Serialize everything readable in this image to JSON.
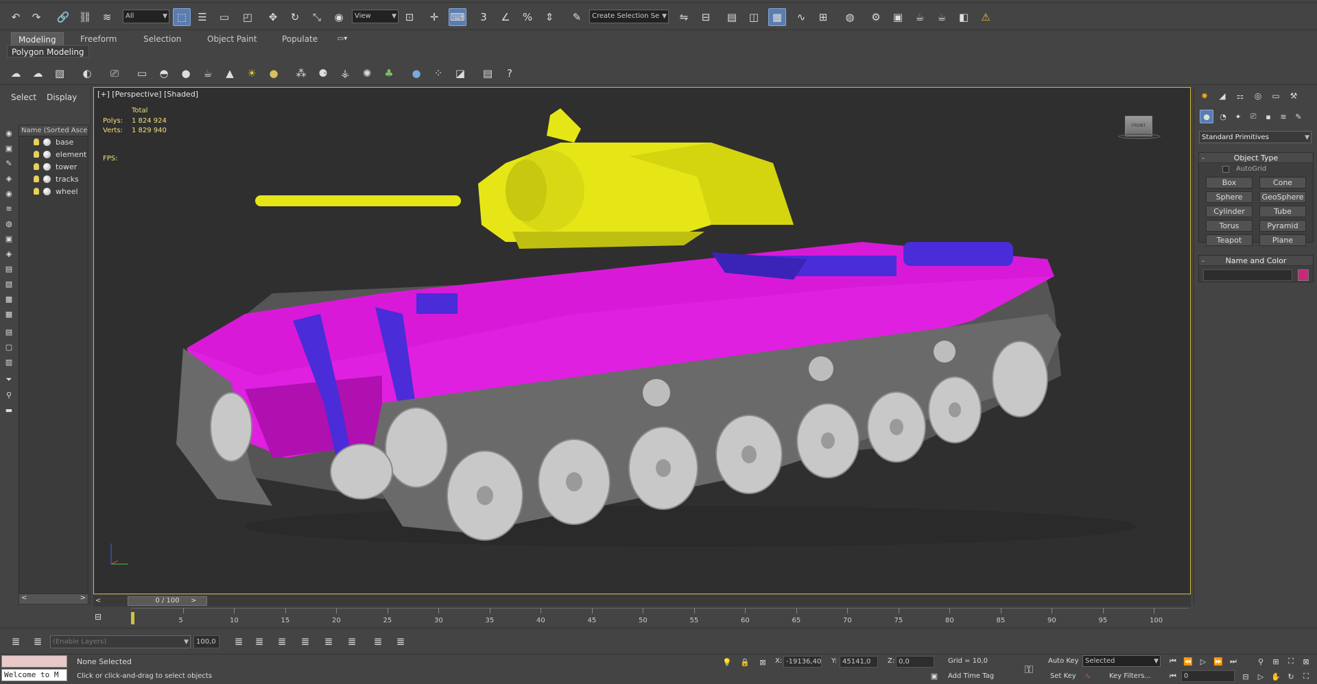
{
  "main_toolbar": {
    "selection_filter": "All",
    "reference_coord": "View",
    "named_selection_placeholder": "Create Selection Se",
    "snap_3d_label": "3",
    "percent_snap_label": "%"
  },
  "ribbon": {
    "tabs": [
      "Modeling",
      "Freeform",
      "Selection",
      "Object Paint",
      "Populate"
    ],
    "active_tab": "Modeling",
    "panel_label": "Polygon Modeling"
  },
  "explorer": {
    "tabs": [
      "Select",
      "Display"
    ],
    "column_header": "Name (Sorted Ascending)",
    "items": [
      "base",
      "element",
      "tower",
      "tracks",
      "wheel"
    ]
  },
  "viewport": {
    "label": "[+] [Perspective] [Shaded]",
    "stats": {
      "total_label": "Total",
      "polys_label": "Polys:",
      "polys_value": "1 824 924",
      "verts_label": "Verts:",
      "verts_value": "1 829 940",
      "fps_label": "FPS:"
    },
    "viewcube_label": "FRONT"
  },
  "command_panel": {
    "category_dropdown": "Standard Primitives",
    "object_type": {
      "title": "Object Type",
      "autogrid_label": "AutoGrid",
      "autogrid_checked": false,
      "buttons": [
        "Box",
        "Cone",
        "Sphere",
        "GeoSphere",
        "Cylinder",
        "Tube",
        "Torus",
        "Pyramid",
        "Teapot",
        "Plane"
      ]
    },
    "name_and_color": {
      "title": "Name and Color",
      "name_value": "",
      "swatch_color": "#c8287a"
    }
  },
  "timeline": {
    "frame_label": "0 / 100",
    "ticks": [
      "5",
      "10",
      "15",
      "20",
      "25",
      "30",
      "35",
      "40",
      "45",
      "50",
      "55",
      "60",
      "65",
      "70",
      "75",
      "80",
      "85",
      "90",
      "95",
      "100"
    ]
  },
  "layer_bar": {
    "layer_dropdown_placeholder": "(Enable Layers)",
    "value": "100,0"
  },
  "status": {
    "maxscript_text": "Welcome to M",
    "selection_status": "None Selected",
    "prompt": "Click or click-and-drag to select objects",
    "x_label": "X:",
    "x_value": "-19136,40",
    "y_label": "Y:",
    "y_value": "45141,0",
    "z_label": "Z:",
    "z_value": "0,0",
    "grid": "Grid = 10,0",
    "add_time_tag": "Add Time Tag",
    "auto_key": "Auto Key",
    "set_key": "Set Key",
    "key_mode_dropdown": "Selected",
    "key_filters": "Key Filters...",
    "current_frame": "0"
  },
  "colors": {
    "viewport_border": "#d4b830",
    "turret": "#e6e617",
    "hull": "#e020e0",
    "details": "#4a2cd8",
    "wheels": "#bdbdbd",
    "stats_text": "#f2e27a"
  }
}
